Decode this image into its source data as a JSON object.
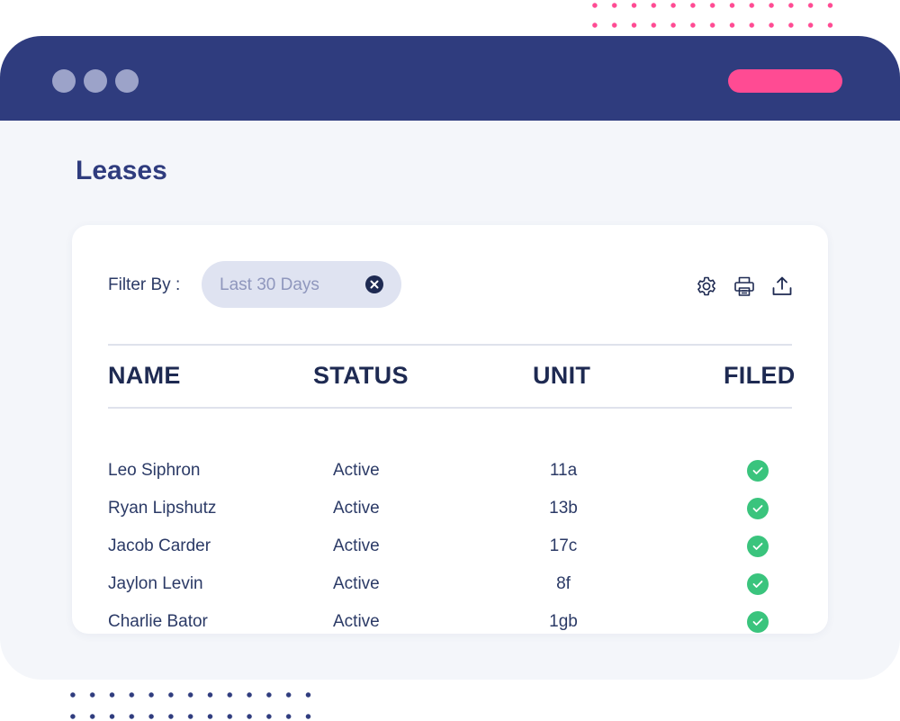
{
  "page": {
    "title": "Leases",
    "colors": {
      "brand_navy": "#2f3c7e",
      "accent_pink": "#ff4b93",
      "success_green": "#3ac47d"
    }
  },
  "filter": {
    "label": "Filter By :",
    "chip_value": "Last 30 Days",
    "clear_icon": "close-circle-icon"
  },
  "toolbar": {
    "icons": [
      "gear-icon",
      "printer-icon",
      "upload-icon"
    ]
  },
  "table": {
    "columns": [
      "NAME",
      "STATUS",
      "UNIT",
      "FILED"
    ],
    "rows": [
      {
        "name": "Leo Siphron",
        "status": "Active",
        "unit": "11a",
        "filed": "check-circle-icon"
      },
      {
        "name": "Ryan Lipshutz",
        "status": "Active",
        "unit": "13b",
        "filed": "check-circle-icon"
      },
      {
        "name": "Jacob Carder",
        "status": "Active",
        "unit": "17c",
        "filed": "check-circle-icon"
      },
      {
        "name": "Jaylon Levin",
        "status": "Active",
        "unit": "8f",
        "filed": "check-circle-icon"
      },
      {
        "name": "Charlie Bator",
        "status": "Active",
        "unit": "1gb",
        "filed": "check-circle-icon"
      }
    ]
  }
}
